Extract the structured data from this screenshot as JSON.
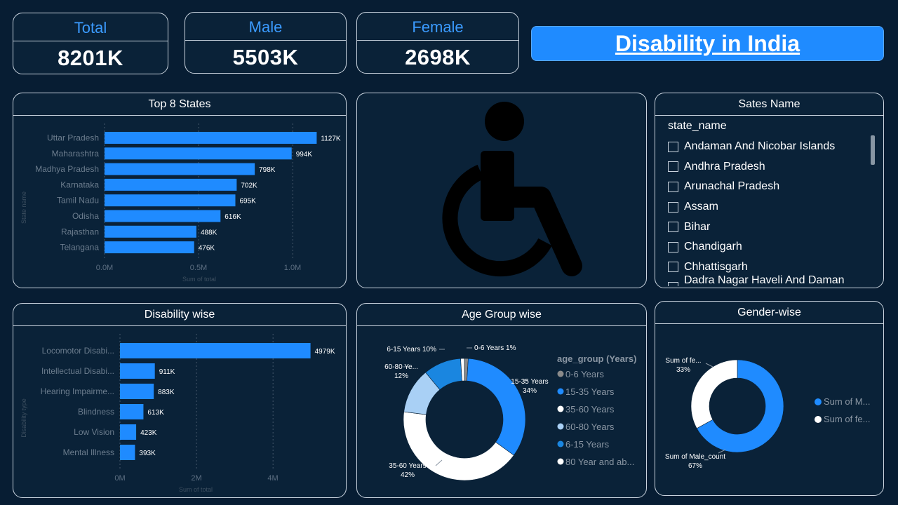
{
  "kpis": [
    {
      "label": "Total",
      "value": "8201K"
    },
    {
      "label": "Male",
      "value": "5503K"
    },
    {
      "label": "Female",
      "value": "2698K"
    }
  ],
  "title": "Disability in India",
  "top_states": {
    "title": "Top 8 States",
    "ylabel": "State name",
    "xlabel": "Sum of total",
    "ticks": [
      "0.0M",
      "0.5M",
      "1.0M"
    ]
  },
  "disability": {
    "title": "Disability wise",
    "ylabel": "Disability type",
    "xlabel": "Sum of total",
    "ticks": [
      "0M",
      "2M",
      "4M"
    ]
  },
  "age": {
    "title": "Age Group wise",
    "legend_title": "age_group (Years)"
  },
  "gender": {
    "title": "Gender-wise",
    "legend": [
      "Sum of M...",
      "Sum of fe..."
    ]
  },
  "slicer": {
    "title": "Sates Name",
    "field": "state_name",
    "items": [
      "Andaman And Nicobar Islands",
      "Andhra Pradesh",
      "Arunachal Pradesh",
      "Assam",
      "Bihar",
      "Chandigarh",
      "Chhattisgarh",
      "Dadra Nagar Haveli And Daman And Diu"
    ]
  },
  "colors": {
    "accent": "#1f8bff",
    "background": "#071d33",
    "panel": "#0a2238",
    "border": "#c9d3de"
  },
  "icons": {
    "hero": "wheelchair-icon"
  },
  "chart_data": [
    {
      "type": "bar",
      "orientation": "horizontal",
      "title": "Top 8 States",
      "xlabel": "Sum of total",
      "ylabel": "State name",
      "xlim": [
        0,
        1200000
      ],
      "categories": [
        "Uttar Pradesh",
        "Maharashtra",
        "Madhya Pradesh",
        "Karnataka",
        "Tamil Nadu",
        "Odisha",
        "Rajasthan",
        "Telangana"
      ],
      "values": [
        1127000,
        994000,
        798000,
        702000,
        695000,
        616000,
        488000,
        476000
      ],
      "labels": [
        "1127K",
        "994K",
        "798K",
        "702K",
        "695K",
        "616K",
        "488K",
        "476K"
      ]
    },
    {
      "type": "bar",
      "orientation": "horizontal",
      "title": "Disability wise",
      "xlabel": "Sum of total",
      "ylabel": "Disability type",
      "xlim": [
        0,
        5500000
      ],
      "categories": [
        "Locomotor Disabi...",
        "Intellectual Disabi...",
        "Hearing Impairme...",
        "Blindness",
        "Low Vision",
        "Mental Illness"
      ],
      "values": [
        4979000,
        911000,
        883000,
        613000,
        423000,
        393000
      ],
      "labels": [
        "4979K",
        "911K",
        "883K",
        "613K",
        "423K",
        "393K"
      ]
    },
    {
      "type": "pie",
      "donut": true,
      "title": "Age Group wise",
      "legend_title": "age_group (Years)",
      "slices": [
        {
          "name": "0-6 Years",
          "value": 1,
          "color": "#8a8a8a",
          "label": "0-6 Years 1%"
        },
        {
          "name": "15-35 Years",
          "value": 34,
          "color": "#1f8bff",
          "label": "15-35 Years 34%"
        },
        {
          "name": "35-60 Years",
          "value": 42,
          "color": "#ffffff",
          "label": "35-60 Years 42%"
        },
        {
          "name": "60-80 Years",
          "value": 12,
          "color": "#a9d0f5",
          "label": "60-80 Ye... 12%"
        },
        {
          "name": "6-15 Years",
          "value": 10,
          "color": "#1a86e0",
          "label": "6-15 Years 10%"
        },
        {
          "name": "80 Year and ab...",
          "value": 1,
          "color": "#ffffff",
          "label": ""
        }
      ]
    },
    {
      "type": "pie",
      "donut": true,
      "title": "Gender-wise",
      "slices": [
        {
          "name": "Sum of Male_count",
          "value": 67,
          "color": "#1f8bff",
          "label": "Sum of Male_count 67%"
        },
        {
          "name": "Sum of fe...",
          "value": 33,
          "color": "#ffffff",
          "label": "Sum of fe... 33%"
        }
      ]
    }
  ]
}
